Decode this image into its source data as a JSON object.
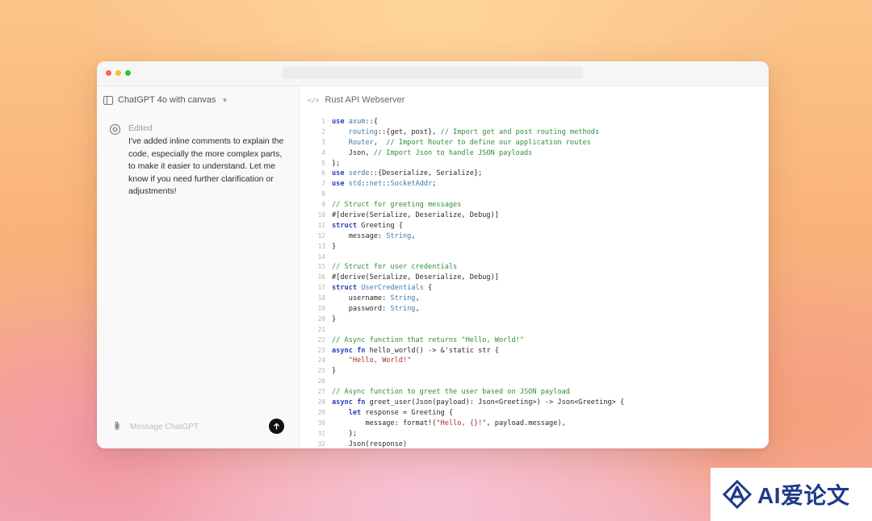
{
  "chat": {
    "title": "ChatGPT 4o with canvas",
    "message_status": "Edited",
    "message_text": "I've added inline comments to explain the code, especially the more complex parts, to make it easier to understand. Let me know if you need further clarification or adjustments!",
    "composer_placeholder": "Message ChatGPT"
  },
  "canvas": {
    "title": "Rust API Webserver"
  },
  "icons": {
    "sidebar_toggle": "sidebar-icon",
    "chevron": "chevron-down-icon",
    "assistant": "chatgpt-logo-icon",
    "attach": "paperclip-icon",
    "send": "arrow-up-icon",
    "code": "code-icon"
  },
  "code_lines": [
    {
      "n": "1",
      "t": "use axum::{"
    },
    {
      "n": "2",
      "t": "    routing::{get, post}, // Import get and post routing methods"
    },
    {
      "n": "3",
      "t": "    Router,  // Import Router to define our application routes"
    },
    {
      "n": "4",
      "t": "    Json, // Import Json to handle JSON payloads"
    },
    {
      "n": "5",
      "t": "};"
    },
    {
      "n": "6",
      "t": "use serde::{Deserialize, Serialize};"
    },
    {
      "n": "7",
      "t": "use std::net::SocketAddr;"
    },
    {
      "n": "8",
      "t": ""
    },
    {
      "n": "9",
      "t": "// Struct for greeting messages"
    },
    {
      "n": "10",
      "t": "#[derive(Serialize, Deserialize, Debug)]"
    },
    {
      "n": "11",
      "t": "struct Greeting {"
    },
    {
      "n": "12",
      "t": "    message: String,"
    },
    {
      "n": "13",
      "t": "}"
    },
    {
      "n": "14",
      "t": ""
    },
    {
      "n": "15",
      "t": "// Struct for user credentials"
    },
    {
      "n": "16",
      "t": "#[derive(Serialize, Deserialize, Debug)]"
    },
    {
      "n": "17",
      "t": "struct UserCredentials {"
    },
    {
      "n": "18",
      "t": "    username: String,"
    },
    {
      "n": "19",
      "t": "    password: String,"
    },
    {
      "n": "20",
      "t": "}"
    },
    {
      "n": "21",
      "t": ""
    },
    {
      "n": "22",
      "t": "// Async function that returns \"Hello, World!\""
    },
    {
      "n": "23",
      "t": "async fn hello_world() -> &'static str {"
    },
    {
      "n": "24",
      "t": "    \"Hello, World!\""
    },
    {
      "n": "25",
      "t": "}"
    },
    {
      "n": "26",
      "t": ""
    },
    {
      "n": "27",
      "t": "// Async function to greet the user based on JSON payload"
    },
    {
      "n": "28",
      "t": "async fn greet_user(Json(payload): Json<Greeting>) -> Json<Greeting> {"
    },
    {
      "n": "29",
      "t": "    let response = Greeting {"
    },
    {
      "n": "30",
      "t": "        message: format!(\"Hello, {}!\", payload.message),"
    },
    {
      "n": "31",
      "t": "    };"
    },
    {
      "n": "32",
      "t": "    Json(response)"
    }
  ],
  "watermark": {
    "text": "AI爱论文"
  },
  "colors": {
    "keyword": "#2c3fb8",
    "comment": "#2f8f3a",
    "type": "#3d7bb0",
    "string": "#b32d2d"
  }
}
